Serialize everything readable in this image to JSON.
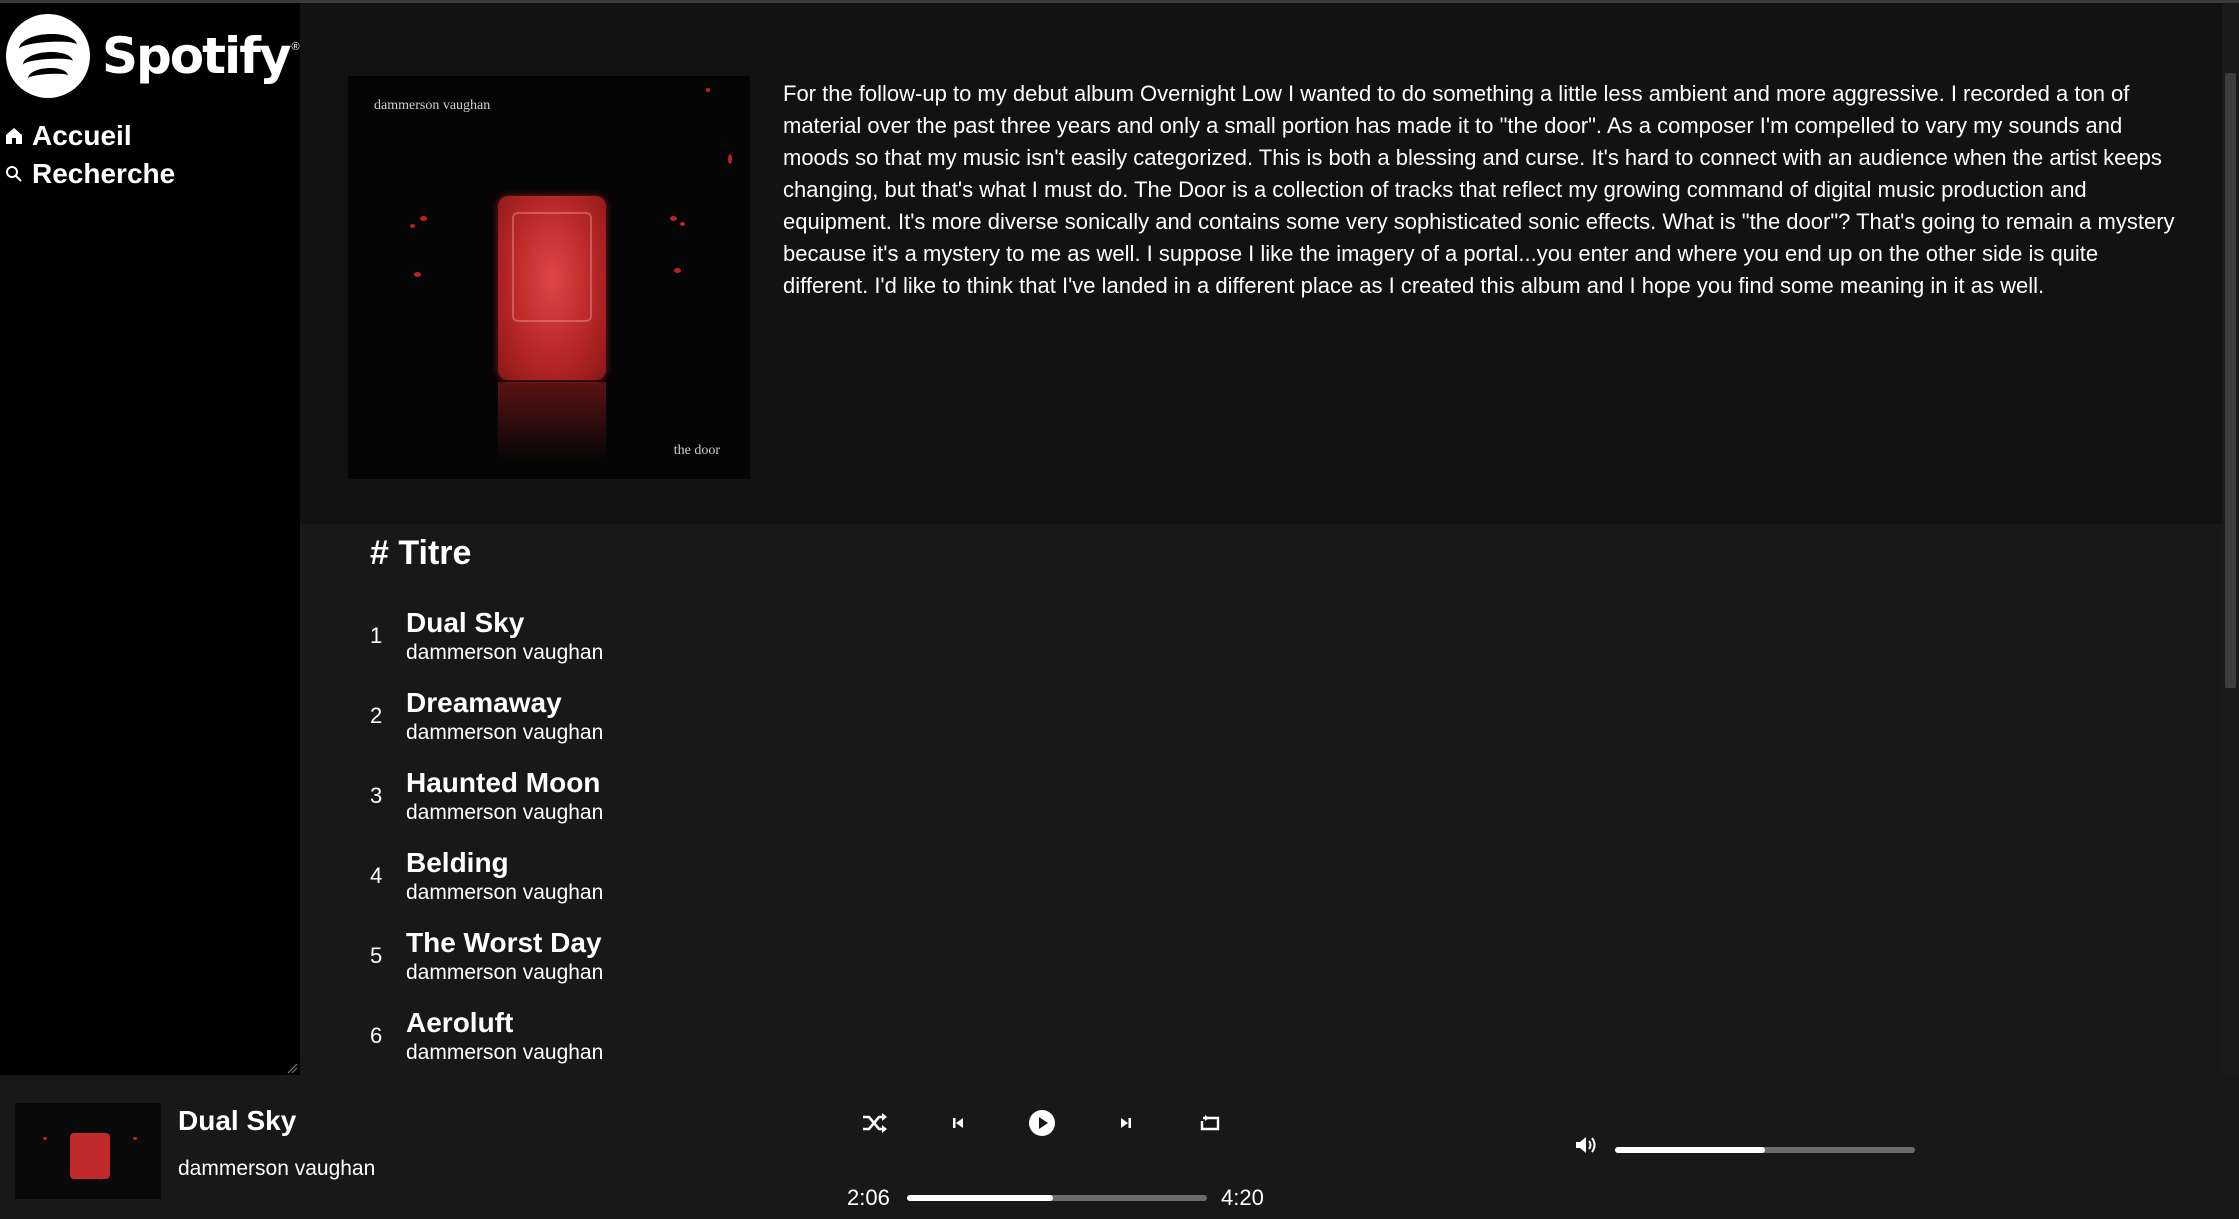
{
  "app": {
    "logo_text": "Spotify",
    "registered_mark": "®"
  },
  "sidebar": {
    "items": [
      {
        "label": "Accueil",
        "icon": "home-icon"
      },
      {
        "label": "Recherche",
        "icon": "search-icon"
      }
    ]
  },
  "album": {
    "cover_artist_text": "dammerson vaughan",
    "cover_title_text": "the door",
    "description": "For the follow-up to my debut album Overnight Low I wanted to do something a little less ambient and more aggressive. I recorded a ton of material over the past three years and only a small portion has made it to \"the door\". As a composer I'm compelled to vary my sounds and moods so that my music isn't easily categorized. This is both a blessing and curse. It's hard to connect with an audience when the artist keeps changing, but that's what I must do. The Door is a collection of tracks that reflect my growing command of digital music production and equipment. It's more diverse sonically and contains some very sophisticated sonic effects. What is \"the door\"? That's going to remain a mystery because it's a mystery to me as well. I suppose I like the imagery of a portal...you enter and where you end up on the other side is quite different. I'd like to think that I've landed in a different place as I created this album and I hope you find some meaning in it as well."
  },
  "tracks": {
    "header": "# Titre",
    "items": [
      {
        "num": "1",
        "title": "Dual Sky",
        "artist": "dammerson vaughan"
      },
      {
        "num": "2",
        "title": "Dreamaway",
        "artist": "dammerson vaughan"
      },
      {
        "num": "3",
        "title": "Haunted Moon",
        "artist": "dammerson vaughan"
      },
      {
        "num": "4",
        "title": "Belding",
        "artist": "dammerson vaughan"
      },
      {
        "num": "5",
        "title": "The Worst Day",
        "artist": "dammerson vaughan"
      },
      {
        "num": "6",
        "title": "Aeroluft",
        "artist": "dammerson vaughan"
      }
    ]
  },
  "player": {
    "now_playing": {
      "title": "Dual Sky",
      "artist": "dammerson vaughan"
    },
    "controls": [
      "shuffle-icon",
      "previous-icon",
      "play-icon",
      "next-icon",
      "repeat-icon"
    ],
    "elapsed": "2:06",
    "duration": "4:20",
    "progress_fraction": 0.485,
    "volume_fraction": 0.5
  },
  "colors": {
    "background": "#000000",
    "main_bg": "#121212",
    "tracks_bg": "#181818",
    "player_bg": "#181818",
    "text": "#ffffff"
  }
}
